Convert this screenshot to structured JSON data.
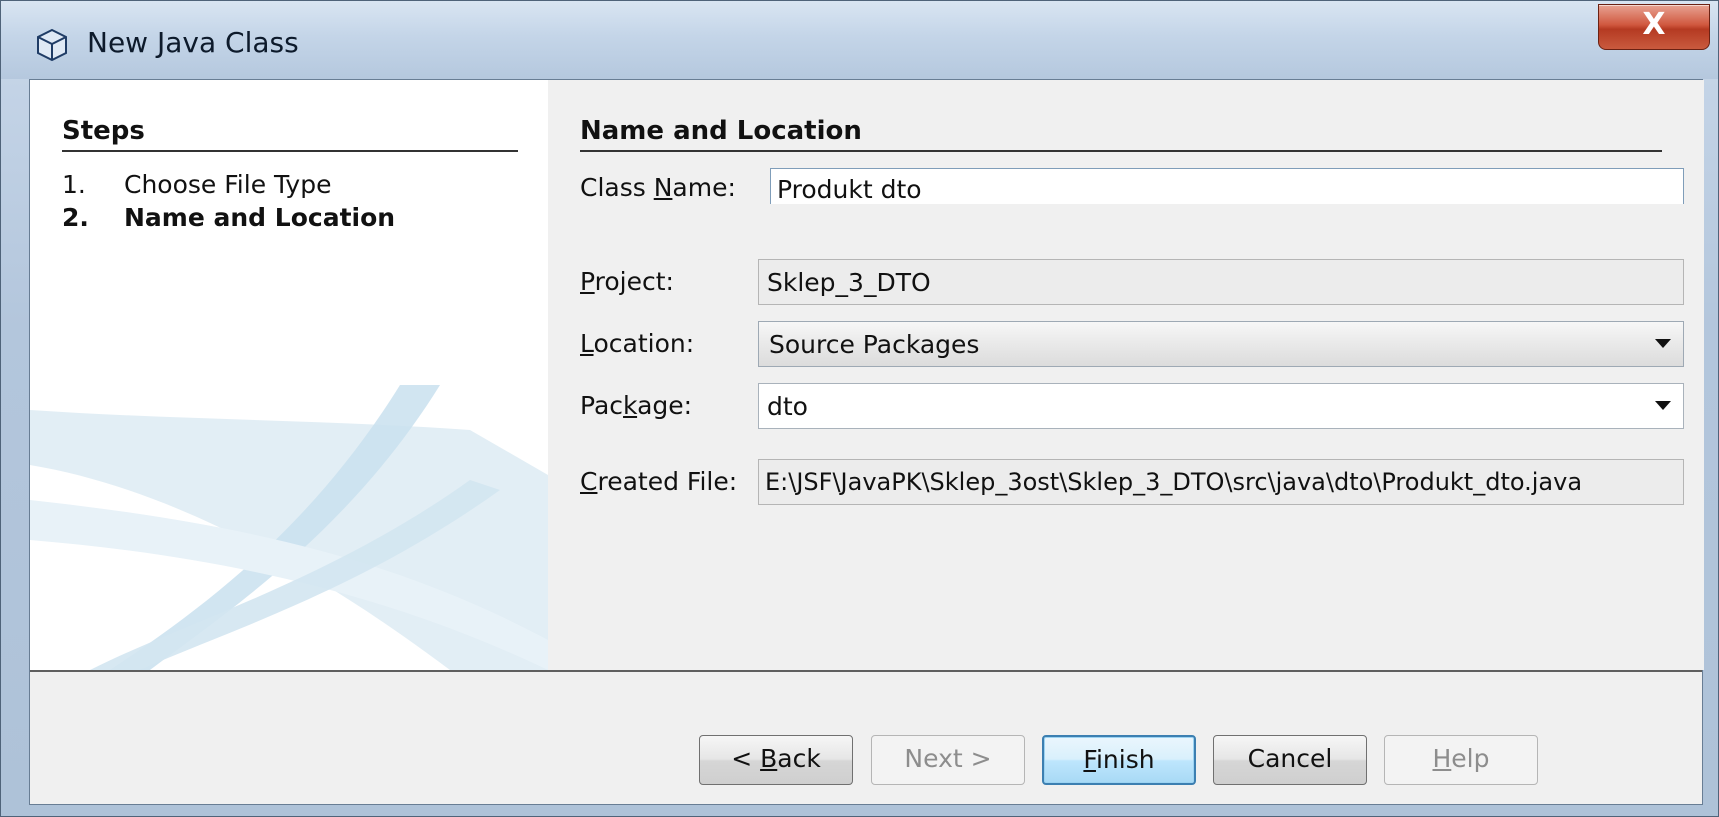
{
  "window": {
    "title": "New Java Class",
    "close_label": "X"
  },
  "steps": {
    "heading": "Steps",
    "items": [
      {
        "num": "1.",
        "label": "Choose File Type"
      },
      {
        "num": "2.",
        "label": "Name and Location"
      }
    ]
  },
  "form": {
    "section_title": "Name and Location",
    "class_name": {
      "label_pre": "Class ",
      "label_key": "N",
      "label_post": "ame:",
      "value": "Produkt  dto"
    },
    "project": {
      "label_pre": "",
      "label_key": "P",
      "label_post": "roject:",
      "value": "Sklep_3_DTO"
    },
    "location": {
      "label_pre": "",
      "label_key": "L",
      "label_post": "ocation:",
      "value": "Source Packages"
    },
    "package": {
      "label_pre": "Pac",
      "label_key": "k",
      "label_post": "age:",
      "value": "dto"
    },
    "created_file": {
      "label_pre": "",
      "label_key": "C",
      "label_post": "reated File:",
      "value": "E:\\JSF\\JavaPK\\Sklep_3ost\\Sklep_3_DTO\\src\\java\\dto\\Produkt_dto.java"
    }
  },
  "buttons": {
    "back": {
      "pre": "< ",
      "key": "B",
      "post": "ack"
    },
    "next": {
      "pre": "",
      "key": "",
      "post": "Next >"
    },
    "finish": {
      "pre": "",
      "key": "F",
      "post": "inish"
    },
    "cancel": {
      "pre": "",
      "key": "",
      "post": "Cancel"
    },
    "help": {
      "pre": "",
      "key": "H",
      "post": "elp"
    }
  },
  "icons": {
    "window_icon": "cube-icon",
    "dropdown": "chevron-down-icon"
  },
  "colors": {
    "default_button": "#3c7fb1",
    "title_bar": "#c4d5e8",
    "close_button": "#c95a3e"
  }
}
